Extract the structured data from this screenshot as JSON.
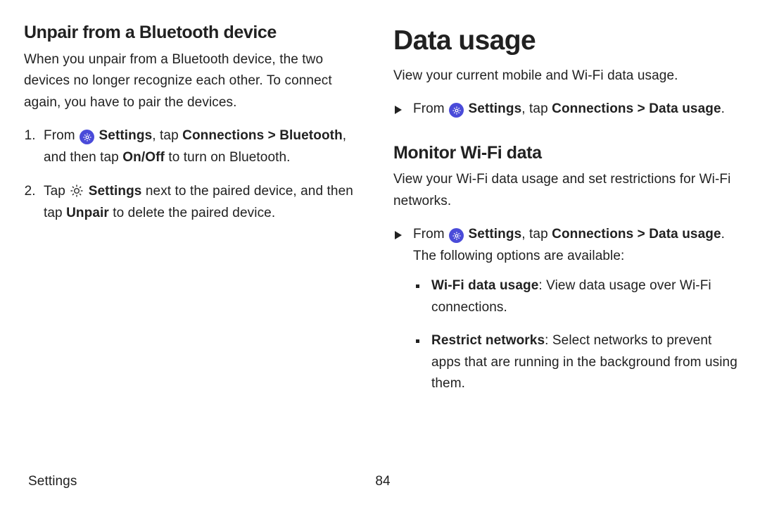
{
  "left": {
    "heading": "Unpair from a Bluetooth device",
    "intro": "When you unpair from a Bluetooth device, the two devices no longer recognize each other. To connect again, you have to pair the devices.",
    "step1": {
      "from": "From ",
      "settings": "Settings",
      "tap": ", tap ",
      "path": "Connections > Bluetooth",
      "then1": ", and then tap ",
      "onoff": "On/Off",
      "then2": " to turn on Bluetooth."
    },
    "step2": {
      "tap": "Tap ",
      "settings": "Settings",
      "next": " next to the paired device, and then tap ",
      "unpair": "Unpair",
      "end": " to delete the paired device."
    }
  },
  "right": {
    "title": "Data usage",
    "intro": "View your current mobile and Wi-Fi data usage.",
    "line1": {
      "from": "From ",
      "settings": "Settings",
      "tap": ", tap ",
      "path": "Connections > Data usage",
      "end": "."
    },
    "h2": "Monitor Wi-Fi data",
    "p2": "View your Wi-Fi data usage and set restrictions for Wi-Fi networks.",
    "line2": {
      "from": "From ",
      "settings": "Settings",
      "tap": ", tap ",
      "path": "Connections > Data usage",
      "end": ". The following options are available:"
    },
    "b1": {
      "label": "Wi-Fi data usage",
      "text": ": View data usage over Wi-Fi connections."
    },
    "b2": {
      "label": "Restrict networks",
      "text": ": Select networks to prevent apps that are running in the background from using them."
    }
  },
  "footer": {
    "section": "Settings",
    "page": "84"
  }
}
